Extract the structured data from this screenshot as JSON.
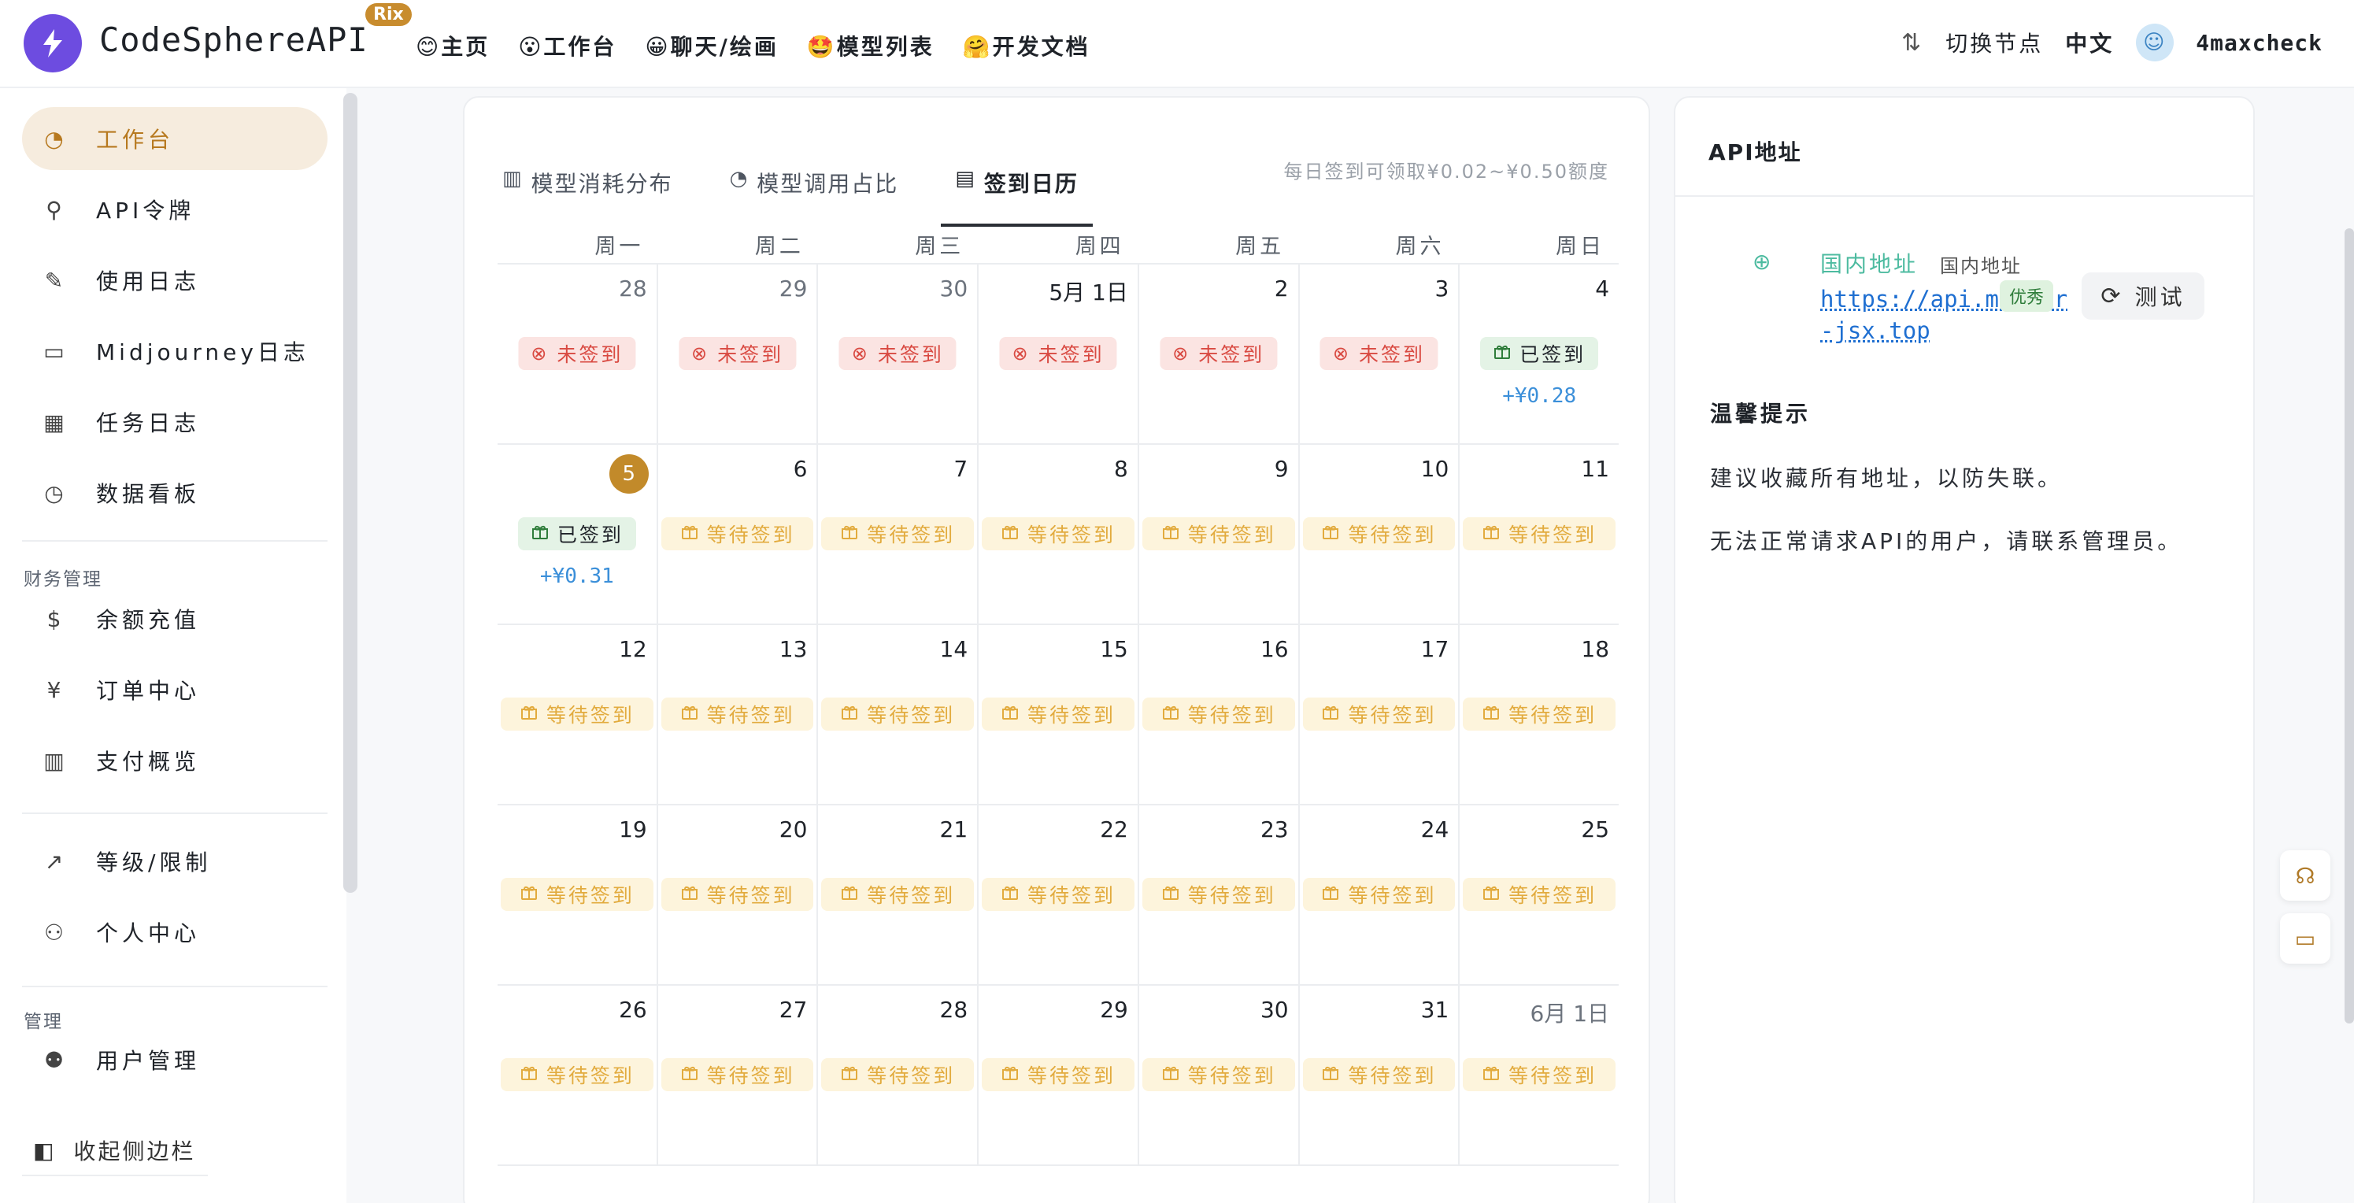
{
  "header": {
    "brand": "CodeSphereAPI",
    "brand_badge": "Rix",
    "nav": [
      "😊主页",
      "😮工作台",
      "😀聊天/绘画",
      "🤩模型列表",
      "🤗开发文档"
    ],
    "switch_node": "切换节点",
    "language": "中文",
    "username": "4maxcheck"
  },
  "sidebar": {
    "items": [
      {
        "label": "工作台",
        "icon": "dashboard-gauge-icon",
        "active": true
      },
      {
        "label": "API令牌",
        "icon": "key-icon"
      },
      {
        "label": "使用日志",
        "icon": "log-icon"
      },
      {
        "label": "Midjourney日志",
        "icon": "image-icon"
      },
      {
        "label": "任务日志",
        "icon": "film-icon"
      },
      {
        "label": "数据看板",
        "icon": "pie-chart-icon"
      }
    ],
    "finance_group": "财务管理",
    "finance_items": [
      {
        "label": "余额充值",
        "icon": "coin-icon"
      },
      {
        "label": "订单中心",
        "icon": "order-icon"
      },
      {
        "label": "支付概览",
        "icon": "bar-chart-icon"
      }
    ],
    "other_items": [
      {
        "label": "等级/限制",
        "icon": "trend-up-icon"
      },
      {
        "label": "个人中心",
        "icon": "user-icon"
      }
    ],
    "admin_group": "管理",
    "admin_items": [
      {
        "label": "用户管理",
        "icon": "users-icon"
      }
    ],
    "collapse_label": "收起侧边栏"
  },
  "calendar_card": {
    "tabs": [
      {
        "label": "模型消耗分布",
        "icon": "bar-chart-icon"
      },
      {
        "label": "模型调用占比",
        "icon": "pie-chart-icon"
      },
      {
        "label": "签到日历",
        "icon": "calendar-icon",
        "active": true
      }
    ],
    "hint": "每日签到可领取¥0.02~¥0.50额度",
    "weekdays": [
      "周一",
      "周二",
      "周三",
      "周四",
      "周五",
      "周六",
      "周日"
    ],
    "status_labels": {
      "missed": "未签到",
      "signed": "已签到",
      "waiting": "等待签到"
    },
    "weeks": [
      [
        {
          "day": "28",
          "other": true,
          "status": "missed"
        },
        {
          "day": "29",
          "other": true,
          "status": "missed"
        },
        {
          "day": "30",
          "other": true,
          "status": "missed"
        },
        {
          "day": "5月 1日",
          "status": "missed"
        },
        {
          "day": "2",
          "status": "missed"
        },
        {
          "day": "3",
          "status": "missed"
        },
        {
          "day": "4",
          "status": "signed",
          "reward": "+¥0.28"
        }
      ],
      [
        {
          "day": "5",
          "today": true,
          "status": "signed",
          "reward": "+¥0.31"
        },
        {
          "day": "6",
          "status": "waiting"
        },
        {
          "day": "7",
          "status": "waiting"
        },
        {
          "day": "8",
          "status": "waiting"
        },
        {
          "day": "9",
          "status": "waiting"
        },
        {
          "day": "10",
          "status": "waiting"
        },
        {
          "day": "11",
          "status": "waiting"
        }
      ],
      [
        {
          "day": "12",
          "status": "waiting"
        },
        {
          "day": "13",
          "status": "waiting"
        },
        {
          "day": "14",
          "status": "waiting"
        },
        {
          "day": "15",
          "status": "waiting"
        },
        {
          "day": "16",
          "status": "waiting"
        },
        {
          "day": "17",
          "status": "waiting"
        },
        {
          "day": "18",
          "status": "waiting"
        }
      ],
      [
        {
          "day": "19",
          "status": "waiting"
        },
        {
          "day": "20",
          "status": "waiting"
        },
        {
          "day": "21",
          "status": "waiting"
        },
        {
          "day": "22",
          "status": "waiting"
        },
        {
          "day": "23",
          "status": "waiting"
        },
        {
          "day": "24",
          "status": "waiting"
        },
        {
          "day": "25",
          "status": "waiting"
        }
      ],
      [
        {
          "day": "26",
          "status": "waiting"
        },
        {
          "day": "27",
          "status": "waiting"
        },
        {
          "day": "28",
          "status": "waiting"
        },
        {
          "day": "29",
          "status": "waiting"
        },
        {
          "day": "30",
          "status": "waiting"
        },
        {
          "day": "31",
          "status": "waiting"
        },
        {
          "day": "6月 1日",
          "other": true,
          "status": "waiting"
        }
      ]
    ]
  },
  "api_card": {
    "title": "API地址",
    "endpoint_name": "国内地址",
    "endpoint_sub": "国内地址",
    "endpoint_url": "https://api.master-jsx.top",
    "endpoint_tag": "优秀",
    "test_label": "测试",
    "tip_title": "温馨提示",
    "tips": [
      "建议收藏所有地址，以防失联。",
      "无法正常请求API的用户，请联系管理员。"
    ]
  },
  "colors": {
    "accent": "#c28a2a",
    "missed": "#d94a42",
    "signed_bg": "#e4f3e6",
    "waiting": "#e2ab3e",
    "reward": "#3b8fd9"
  }
}
